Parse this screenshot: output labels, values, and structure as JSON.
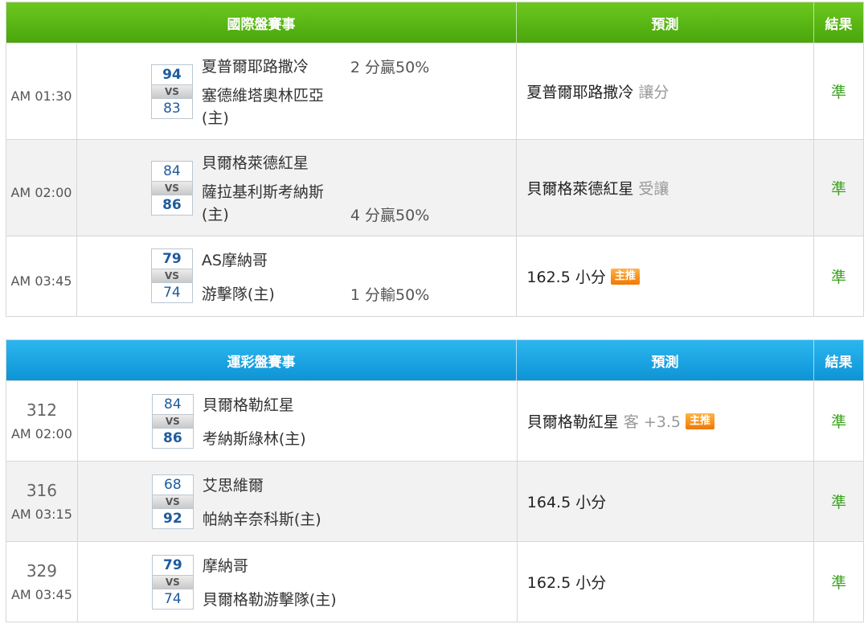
{
  "international": {
    "header": {
      "game": "國際盤賽事",
      "prediction": "預測",
      "result": "結果"
    },
    "rows": [
      {
        "time": "AM 01:30",
        "score_top": "94",
        "score_bottom": "83",
        "vs": "VS",
        "team_top": "夏普爾耶路撒冷",
        "team_bottom": "塞德維塔奧林匹亞",
        "team_bottom_note": "(主)",
        "handicap": "2 分贏50%",
        "prediction": "夏普爾耶路撒冷",
        "prediction_note": "讓分",
        "badge": "",
        "result": "準"
      },
      {
        "time": "AM 02:00",
        "score_top": "84",
        "score_bottom": "86",
        "vs": "VS",
        "team_top": "貝爾格萊德紅星",
        "team_bottom": "薩拉基利斯考納斯",
        "team_bottom_note": "(主)",
        "handicap": "4 分贏50%",
        "prediction": "貝爾格萊德紅星",
        "prediction_note": "受讓",
        "badge": "",
        "result": "準"
      },
      {
        "time": "AM 03:45",
        "score_top": "79",
        "score_bottom": "74",
        "vs": "VS",
        "team_top": "AS摩納哥",
        "team_bottom": "游擊隊(主)",
        "team_bottom_note": "",
        "handicap": "1 分輸50%",
        "prediction": "162.5 小分",
        "prediction_note": "",
        "badge": "主推",
        "result": "準"
      }
    ]
  },
  "sportslottery": {
    "header": {
      "game": "運彩盤賽事",
      "prediction": "預測",
      "result": "結果"
    },
    "rows": [
      {
        "code": "312",
        "time": "AM 02:00",
        "score_top": "84",
        "score_bottom": "86",
        "vs": "VS",
        "team_top": "貝爾格勒紅星",
        "team_bottom": "考納斯綠林(主)",
        "prediction": "貝爾格勒紅星",
        "prediction_note": "客 +3.5",
        "badge": "主推",
        "result": "準"
      },
      {
        "code": "316",
        "time": "AM 03:15",
        "score_top": "68",
        "score_bottom": "92",
        "vs": "VS",
        "team_top": "艾思維爾",
        "team_bottom": "帕納辛奈科斯(主)",
        "prediction": "164.5 小分",
        "prediction_note": "",
        "badge": "",
        "result": "準"
      },
      {
        "code": "329",
        "time": "AM 03:45",
        "score_top": "79",
        "score_bottom": "74",
        "vs": "VS",
        "team_top": "摩納哥",
        "team_bottom": "貝爾格勒游擊隊(主)",
        "prediction": "162.5 小分",
        "prediction_note": "",
        "badge": "",
        "result": "準"
      }
    ]
  }
}
